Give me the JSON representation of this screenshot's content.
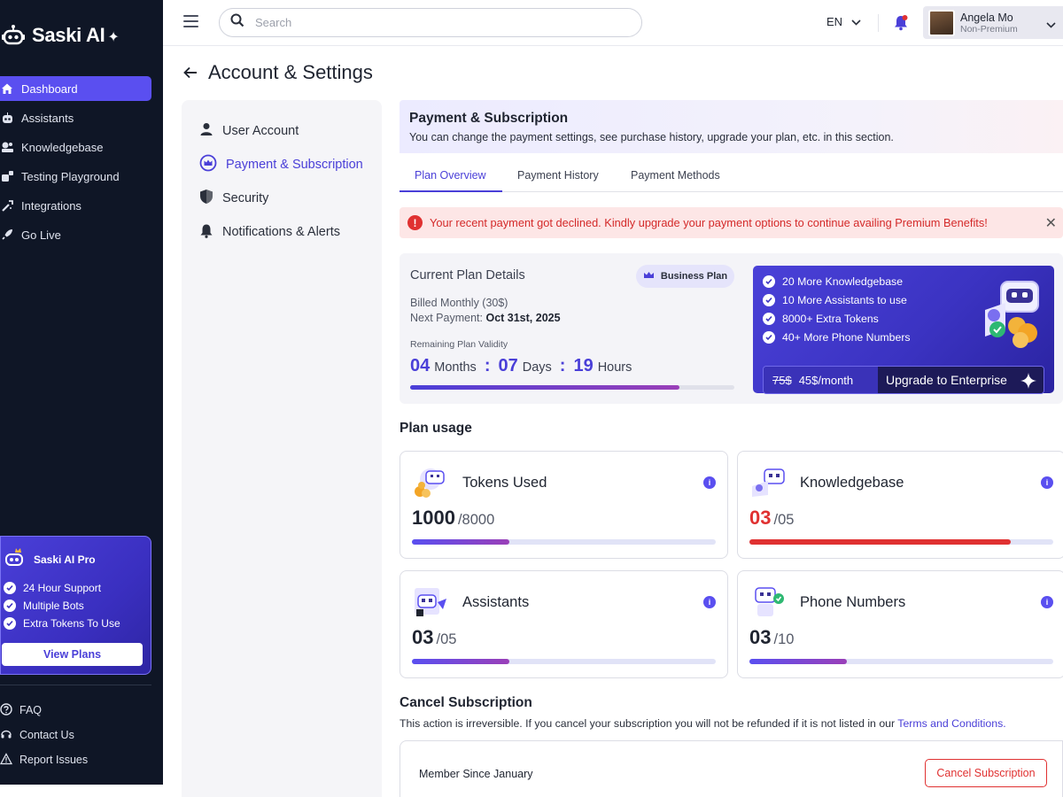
{
  "brand": {
    "name": "Saski AI",
    "spark": "✦"
  },
  "sidebar": {
    "items": [
      {
        "label": "Dashboard",
        "icon": "home-icon",
        "active": true
      },
      {
        "label": "Assistants",
        "icon": "robot-icon"
      },
      {
        "label": "Knowledgebase",
        "icon": "knowledgebase-icon"
      },
      {
        "label": "Testing Playground",
        "icon": "playground-icon"
      },
      {
        "label": "Integrations",
        "icon": "integrations-icon"
      },
      {
        "label": "Go Live",
        "icon": "rocket-icon"
      }
    ],
    "pro_card": {
      "title": "Saski AI Pro",
      "features": [
        "24 Hour Support",
        "Multiple Bots",
        "Extra Tokens To Use"
      ],
      "button": "View Plans"
    },
    "bottom_links": [
      {
        "label": "FAQ",
        "icon": "help-icon"
      },
      {
        "label": "Contact Us",
        "icon": "headset-icon"
      },
      {
        "label": "Report Issues",
        "icon": "warning-icon"
      }
    ]
  },
  "topbar": {
    "search_placeholder": "Search",
    "language": "EN",
    "user": {
      "name": "Angela Mo",
      "status": "Non-Premium"
    }
  },
  "page": {
    "title": "Account & Settings"
  },
  "settings_nav": [
    {
      "label": "User Account",
      "icon": "user-icon"
    },
    {
      "label": "Payment & Subscription",
      "icon": "crown-icon",
      "active": true
    },
    {
      "label": "Security",
      "icon": "shield-icon"
    },
    {
      "label": "Notifications & Alerts",
      "icon": "bell-icon"
    }
  ],
  "section": {
    "title": "Payment & Subscription",
    "description": "You can change the payment settings, see purchase history, upgrade your plan, etc. in this section."
  },
  "tabs": [
    "Plan Overview",
    "Payment History",
    "Payment Methods"
  ],
  "alert": {
    "message": "Your recent payment got declined. Kindly upgrade your payment options to continue availing Premium Benefits!",
    "color": "#e03131"
  },
  "plan": {
    "title": "Current Plan Details",
    "badge": "Business Plan",
    "billed": "Billed Monthly (30$)",
    "next_payment_label": "Next Payment:",
    "next_payment_date": "Oct 31st, 2025",
    "validity_label": "Remaining Plan Validity",
    "months": "04",
    "months_label": "Months",
    "days": "07",
    "days_label": "Days",
    "hours": "19",
    "hours_label": "Hours",
    "validity_progress": 0.83
  },
  "enterprise": {
    "features": [
      "20 More Knowledgebase",
      "10 More Assistants to use",
      "8000+ Extra Tokens",
      "40+ More Phone Numbers"
    ],
    "old_price": "75$",
    "new_price": "45$/month",
    "button": "Upgrade to Enterprise"
  },
  "usage": {
    "title": "Plan usage",
    "cards": [
      {
        "label": "Tokens Used",
        "value": "1000",
        "total": "/8000",
        "progress": 0.32,
        "alert": false
      },
      {
        "label": "Knowledgebase",
        "value": "03",
        "total": "/05",
        "progress": 0.86,
        "alert": true
      },
      {
        "label": "Assistants",
        "value": "03",
        "total": "/05",
        "progress": 0.32,
        "alert": false
      },
      {
        "label": "Phone Numbers",
        "value": "03",
        "total": "/10",
        "progress": 0.32,
        "alert": false
      }
    ]
  },
  "cancel": {
    "title": "Cancel Subscription",
    "description": "This action is irreversible. If you cancel your subscription you will not be refunded if it is not listed in our",
    "link": "Terms and Conditions.",
    "member_since": "Member Since January",
    "button": "Cancel Subscription"
  },
  "colors": {
    "accent": "#4a3fd8",
    "danger": "#e03131",
    "sidebar_bg": "#0f1626"
  }
}
